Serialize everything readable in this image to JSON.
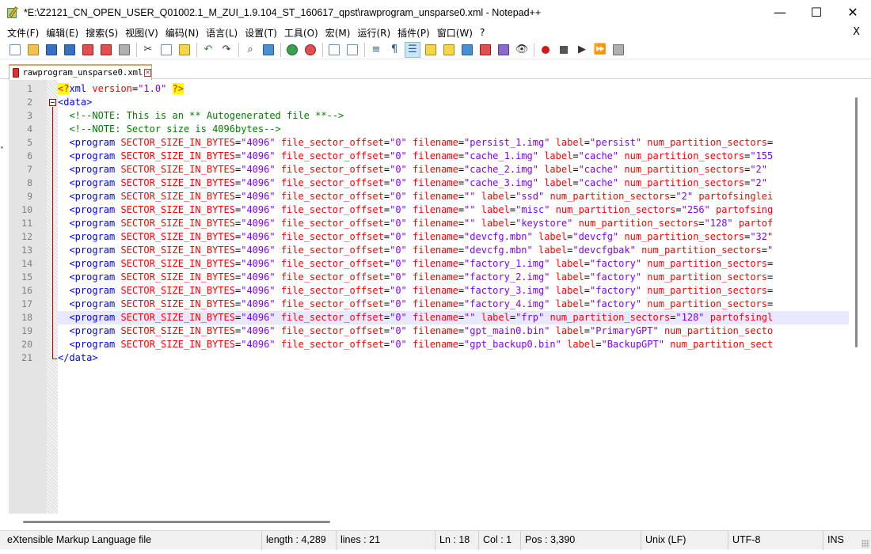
{
  "window": {
    "title": "*E:\\Z2121_CN_OPEN_USER_Q01002.1_M_ZUI_1.9.104_ST_160617_qpst\\rawprogram_unsparse0.xml - Notepad++",
    "minimize": "—",
    "maximize": "☐",
    "close": "✕"
  },
  "menu": {
    "items": [
      "文件(F)",
      "编辑(E)",
      "搜索(S)",
      "视图(V)",
      "编码(N)",
      "语言(L)",
      "设置(T)",
      "工具(O)",
      "宏(M)",
      "运行(R)",
      "插件(P)",
      "窗口(W)",
      "?"
    ],
    "close": "X"
  },
  "toolbar": {
    "icons": [
      "new-file-icon",
      "open-file-icon",
      "save-icon",
      "save-all-icon",
      "close-icon",
      "close-all-icon",
      "print-icon",
      "cut-icon",
      "copy-icon",
      "paste-icon",
      "undo-icon",
      "redo-icon",
      "find-icon",
      "replace-icon",
      "zoom-in-icon",
      "zoom-out-icon",
      "sync-vertical-icon",
      "sync-horizontal-icon",
      "word-wrap-icon",
      "show-all-chars-icon",
      "indent-guide-icon",
      "udl-icon",
      "doc-map-icon",
      "function-list-icon",
      "folder-as-workspace-icon",
      "doc-list-icon",
      "monitoring-icon",
      "record-macro-icon",
      "stop-macro-icon",
      "play-macro-icon",
      "run-macro-multiple-icon",
      "save-macro-icon"
    ]
  },
  "tab": {
    "label": "rawprogram_unsparse0.xml",
    "close": "✕",
    "accent": "#f0a050"
  },
  "editor": {
    "current_line": 18,
    "lines": [
      {
        "n": "1",
        "html": "<span class=\"t-pi\">&lt;?</span><span class=\"t-pit\">xml</span> <span class=\"t-attr\">version</span><span class=\"t-eq\">=</span><span class=\"t-val\">\"1.0\"</span> <span class=\"t-pi\">?&gt;</span>",
        "indent": 0
      },
      {
        "n": "2",
        "html": "<span class=\"t-tag\">&lt;data&gt;</span>",
        "indent": 0
      },
      {
        "n": "3",
        "html": "  <span class=\"t-cm\">&lt;!--NOTE: This is an ** Autogenerated file **--&gt;</span>",
        "indent": 0
      },
      {
        "n": "4",
        "html": "  <span class=\"t-cm\">&lt;!--NOTE: Sector size is 4096bytes--&gt;</span>",
        "indent": 0
      },
      {
        "n": "5",
        "html": "  <span class=\"t-tag\">&lt;program</span> <span class=\"t-attr\">SECTOR_SIZE_IN_BYTES</span>=<span class=\"t-val\">\"4096\"</span> <span class=\"t-attr\">file_sector_offset</span>=<span class=\"t-val\">\"0\"</span> <span class=\"t-attr\">filename</span>=<span class=\"t-val\">\"persist_1.img\"</span> <span class=\"t-attr\">label</span>=<span class=\"t-val\">\"persist\"</span> <span class=\"t-attr\">num_partition_sectors</span>=",
        "indent": 0
      },
      {
        "n": "6",
        "html": "  <span class=\"t-tag\">&lt;program</span> <span class=\"t-attr\">SECTOR_SIZE_IN_BYTES</span>=<span class=\"t-val\">\"4096\"</span> <span class=\"t-attr\">file_sector_offset</span>=<span class=\"t-val\">\"0\"</span> <span class=\"t-attr\">filename</span>=<span class=\"t-val\">\"cache_1.img\"</span> <span class=\"t-attr\">label</span>=<span class=\"t-val\">\"cache\"</span> <span class=\"t-attr\">num_partition_sectors</span>=<span class=\"t-val\">\"155</span>",
        "indent": 0
      },
      {
        "n": "7",
        "html": "  <span class=\"t-tag\">&lt;program</span> <span class=\"t-attr\">SECTOR_SIZE_IN_BYTES</span>=<span class=\"t-val\">\"4096\"</span> <span class=\"t-attr\">file_sector_offset</span>=<span class=\"t-val\">\"0\"</span> <span class=\"t-attr\">filename</span>=<span class=\"t-val\">\"cache_2.img\"</span> <span class=\"t-attr\">label</span>=<span class=\"t-val\">\"cache\"</span> <span class=\"t-attr\">num_partition_sectors</span>=<span class=\"t-val\">\"2\"</span>",
        "indent": 0
      },
      {
        "n": "8",
        "html": "  <span class=\"t-tag\">&lt;program</span> <span class=\"t-attr\">SECTOR_SIZE_IN_BYTES</span>=<span class=\"t-val\">\"4096\"</span> <span class=\"t-attr\">file_sector_offset</span>=<span class=\"t-val\">\"0\"</span> <span class=\"t-attr\">filename</span>=<span class=\"t-val\">\"cache_3.img\"</span> <span class=\"t-attr\">label</span>=<span class=\"t-val\">\"cache\"</span> <span class=\"t-attr\">num_partition_sectors</span>=<span class=\"t-val\">\"2\"</span>",
        "indent": 0
      },
      {
        "n": "9",
        "html": "  <span class=\"t-tag\">&lt;program</span> <span class=\"t-attr\">SECTOR_SIZE_IN_BYTES</span>=<span class=\"t-val\">\"4096\"</span> <span class=\"t-attr\">file_sector_offset</span>=<span class=\"t-val\">\"0\"</span> <span class=\"t-attr\">filename</span>=<span class=\"t-val\">\"\"</span> <span class=\"t-attr\">label</span>=<span class=\"t-val\">\"ssd\"</span> <span class=\"t-attr\">num_partition_sectors</span>=<span class=\"t-val\">\"2\"</span> <span class=\"t-attr\">partofsinglei</span>",
        "indent": 0
      },
      {
        "n": "10",
        "html": "  <span class=\"t-tag\">&lt;program</span> <span class=\"t-attr\">SECTOR_SIZE_IN_BYTES</span>=<span class=\"t-val\">\"4096\"</span> <span class=\"t-attr\">file_sector_offset</span>=<span class=\"t-val\">\"0\"</span> <span class=\"t-attr\">filename</span>=<span class=\"t-val\">\"\"</span> <span class=\"t-attr\">label</span>=<span class=\"t-val\">\"misc\"</span> <span class=\"t-attr\">num_partition_sectors</span>=<span class=\"t-val\">\"256\"</span> <span class=\"t-attr\">partofsing</span>",
        "indent": 0
      },
      {
        "n": "11",
        "html": "  <span class=\"t-tag\">&lt;program</span> <span class=\"t-attr\">SECTOR_SIZE_IN_BYTES</span>=<span class=\"t-val\">\"4096\"</span> <span class=\"t-attr\">file_sector_offset</span>=<span class=\"t-val\">\"0\"</span> <span class=\"t-attr\">filename</span>=<span class=\"t-val\">\"\"</span> <span class=\"t-attr\">label</span>=<span class=\"t-val\">\"keystore\"</span> <span class=\"t-attr\">num_partition_sectors</span>=<span class=\"t-val\">\"128\"</span> <span class=\"t-attr\">partof</span>",
        "indent": 0
      },
      {
        "n": "12",
        "html": "  <span class=\"t-tag\">&lt;program</span> <span class=\"t-attr\">SECTOR_SIZE_IN_BYTES</span>=<span class=\"t-val\">\"4096\"</span> <span class=\"t-attr\">file_sector_offset</span>=<span class=\"t-val\">\"0\"</span> <span class=\"t-attr\">filename</span>=<span class=\"t-val\">\"devcfg.mbn\"</span> <span class=\"t-attr\">label</span>=<span class=\"t-val\">\"devcfg\"</span> <span class=\"t-attr\">num_partition_sectors</span>=<span class=\"t-val\">\"32\"</span>",
        "indent": 0
      },
      {
        "n": "13",
        "html": "  <span class=\"t-tag\">&lt;program</span> <span class=\"t-attr\">SECTOR_SIZE_IN_BYTES</span>=<span class=\"t-val\">\"4096\"</span> <span class=\"t-attr\">file_sector_offset</span>=<span class=\"t-val\">\"0\"</span> <span class=\"t-attr\">filename</span>=<span class=\"t-val\">\"devcfg.mbn\"</span> <span class=\"t-attr\">label</span>=<span class=\"t-val\">\"devcfgbak\"</span> <span class=\"t-attr\">num_partition_sectors</span>=<span class=\"t-val\">\"</span>",
        "indent": 0
      },
      {
        "n": "14",
        "html": "  <span class=\"t-tag\">&lt;program</span> <span class=\"t-attr\">SECTOR_SIZE_IN_BYTES</span>=<span class=\"t-val\">\"4096\"</span> <span class=\"t-attr\">file_sector_offset</span>=<span class=\"t-val\">\"0\"</span> <span class=\"t-attr\">filename</span>=<span class=\"t-val\">\"factory_1.img\"</span> <span class=\"t-attr\">label</span>=<span class=\"t-val\">\"factory\"</span> <span class=\"t-attr\">num_partition_sectors</span>=",
        "indent": 0
      },
      {
        "n": "15",
        "html": "  <span class=\"t-tag\">&lt;program</span> <span class=\"t-attr\">SECTOR_SIZE_IN_BYTES</span>=<span class=\"t-val\">\"4096\"</span> <span class=\"t-attr\">file_sector_offset</span>=<span class=\"t-val\">\"0\"</span> <span class=\"t-attr\">filename</span>=<span class=\"t-val\">\"factory_2.img\"</span> <span class=\"t-attr\">label</span>=<span class=\"t-val\">\"factory\"</span> <span class=\"t-attr\">num_partition_sectors</span>=",
        "indent": 0
      },
      {
        "n": "16",
        "html": "  <span class=\"t-tag\">&lt;program</span> <span class=\"t-attr\">SECTOR_SIZE_IN_BYTES</span>=<span class=\"t-val\">\"4096\"</span> <span class=\"t-attr\">file_sector_offset</span>=<span class=\"t-val\">\"0\"</span> <span class=\"t-attr\">filename</span>=<span class=\"t-val\">\"factory_3.img\"</span> <span class=\"t-attr\">label</span>=<span class=\"t-val\">\"factory\"</span> <span class=\"t-attr\">num_partition_sectors</span>=",
        "indent": 0
      },
      {
        "n": "17",
        "html": "  <span class=\"t-tag\">&lt;program</span> <span class=\"t-attr\">SECTOR_SIZE_IN_BYTES</span>=<span class=\"t-val\">\"4096\"</span> <span class=\"t-attr\">file_sector_offset</span>=<span class=\"t-val\">\"0\"</span> <span class=\"t-attr\">filename</span>=<span class=\"t-val\">\"factory_4.img\"</span> <span class=\"t-attr\">label</span>=<span class=\"t-val\">\"factory\"</span> <span class=\"t-attr\">num_partition_sectors</span>=",
        "indent": 0
      },
      {
        "n": "18",
        "html": "  <span class=\"t-tag\">&lt;program</span> <span class=\"t-attr\">SECTOR_SIZE_IN_BYTES</span>=<span class=\"t-val\">\"4096\"</span> <span class=\"t-attr\">file_sector_offset</span>=<span class=\"t-val\">\"0\"</span> <span class=\"t-attr\">filename</span>=<span class=\"t-val\">\"\"</span> <span class=\"t-attr\">label</span>=<span class=\"t-val\">\"frp\"</span> <span class=\"t-attr\">num_partition_sectors</span>=<span class=\"t-val\">\"128\"</span> <span class=\"t-attr\">partofsingl</span>",
        "indent": 0
      },
      {
        "n": "19",
        "html": "  <span class=\"t-tag\">&lt;program</span> <span class=\"t-attr\">SECTOR_SIZE_IN_BYTES</span>=<span class=\"t-val\">\"4096\"</span> <span class=\"t-attr\">file_sector_offset</span>=<span class=\"t-val\">\"0\"</span> <span class=\"t-attr\">filename</span>=<span class=\"t-val\">\"gpt_main0.bin\"</span> <span class=\"t-attr\">label</span>=<span class=\"t-val\">\"PrimaryGPT\"</span> <span class=\"t-attr\">num_partition_secto</span>",
        "indent": 0
      },
      {
        "n": "20",
        "html": "  <span class=\"t-tag\">&lt;program</span> <span class=\"t-attr\">SECTOR_SIZE_IN_BYTES</span>=<span class=\"t-val\">\"4096\"</span> <span class=\"t-attr\">file_sector_offset</span>=<span class=\"t-val\">\"0\"</span> <span class=\"t-attr\">filename</span>=<span class=\"t-val\">\"gpt_backup0.bin\"</span> <span class=\"t-attr\">label</span>=<span class=\"t-val\">\"BackupGPT\"</span> <span class=\"t-attr\">num_partition_sect</span>",
        "indent": 0
      },
      {
        "n": "21",
        "html": "<span class=\"t-tag\">&lt;/data&gt;</span>",
        "indent": 0
      }
    ]
  },
  "status": {
    "file_type": "eXtensible Markup Language file",
    "length": "length : 4,289",
    "lines": "lines : 21",
    "ln": "Ln : 18",
    "col": "Col : 1",
    "pos": "Pos : 3,390",
    "eol": "Unix (LF)",
    "encoding": "UTF-8",
    "mode": "INS"
  },
  "colors": {
    "tag": "#0000ff",
    "attribute": "#ff0000",
    "value": "#8000ff",
    "comment": "#008000",
    "current_line": "#e8e8ff"
  },
  "left_edge_mark": "\""
}
